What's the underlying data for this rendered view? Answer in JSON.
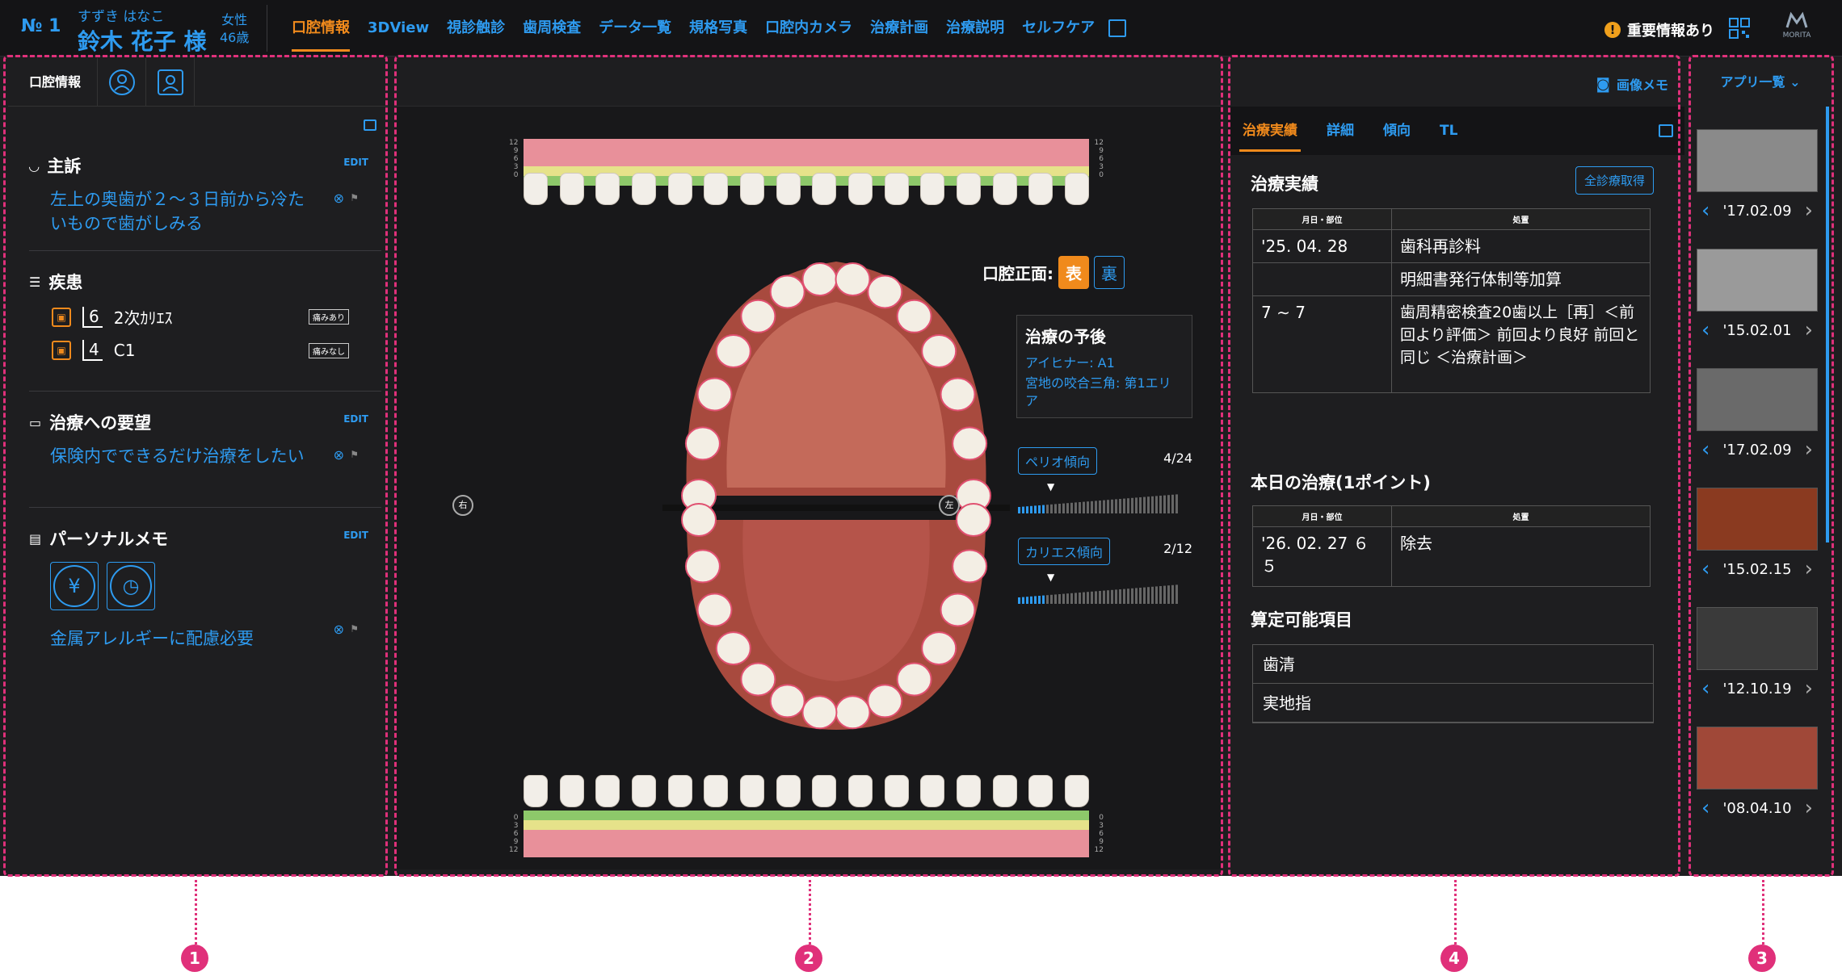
{
  "patient": {
    "number": "№ 1",
    "kana": "すずき はなこ",
    "name": "鈴木 花子 様",
    "sex": "女性",
    "age": "46歳"
  },
  "nav": {
    "tabs": [
      "口腔情報",
      "3DView",
      "視診触診",
      "歯周検査",
      "データ一覧",
      "規格写真",
      "口腔内カメラ",
      "治療計画",
      "治療説明",
      "セルフケア"
    ],
    "active_index": 0
  },
  "header": {
    "notice": "重要情報あり",
    "brand": "MORITA"
  },
  "left": {
    "title": "口腔情報",
    "complaint_title": "主訴",
    "complaint_text": "左上の奥歯が２～３日前から冷たいもので歯がしみる",
    "edit": "EDIT",
    "disease_title": "疾患",
    "diseases": [
      {
        "tooth": "6",
        "name": "2次ｶﾘｴｽ",
        "badge": "痛みあり"
      },
      {
        "tooth": "4",
        "name": "C1",
        "badge": "痛みなし"
      }
    ],
    "request_title": "治療への要望",
    "request_text": "保険内でできるだけ治療をしたい",
    "memo_title": "パーソナルメモ",
    "memo_text": "金属アレルギーに配慮必要",
    "memo_icons": [
      "yen-icon",
      "clock-icon"
    ]
  },
  "center": {
    "surface_label": "口腔正面:",
    "surface_front": "表",
    "surface_back": "裏",
    "prognosis_title": "治療の予後",
    "prognosis_line1": "アイヒナー: A1",
    "prognosis_line2": "宮地の咬合三角: 第1エリア",
    "perio_label": "ペリオ傾向",
    "perio_value": "4/24",
    "perio_fraction": 0.1667,
    "caries_label": "カリエス傾向",
    "caries_value": "2/12",
    "caries_fraction": 0.1667,
    "right_label": "右",
    "left_label": "左",
    "chart_ticks": [
      "12",
      "9",
      "6",
      "3",
      "0"
    ]
  },
  "right": {
    "photo_memo": "画像メモ",
    "tabs": [
      "治療実績",
      "詳細",
      "傾向",
      "TL"
    ],
    "active_tab": 0,
    "history_title": "治療実績",
    "fetch_button": "全診療取得",
    "col_date": "月日・部位",
    "col_action": "処置",
    "history_rows": [
      {
        "date": "'25. 04. 28",
        "action": "歯科再診料"
      },
      {
        "date": "",
        "action": "明細書発行体制等加算"
      },
      {
        "date": "7 ∼ 7",
        "action": "歯周精密検査20歯以上［再］＜前回より評価＞ 前回より良好 前回と同じ ＜治療計画＞"
      }
    ],
    "today_title": "本日の治療(1ポイント)",
    "today_rows": [
      {
        "date": "'26. 02. 27 ６５ ",
        "action": "除去"
      }
    ],
    "calc_title": "算定可能項目",
    "calc_items": [
      "歯清",
      "実地指"
    ]
  },
  "thumbs": {
    "menu": "アプリ一覧",
    "items": [
      {
        "date": "'17.02.09",
        "color": "#8a8a8a"
      },
      {
        "date": "'15.02.01",
        "color": "#9a9a9a"
      },
      {
        "date": "'17.02.09",
        "color": "#6a6a6a"
      },
      {
        "date": "'15.02.15",
        "color": "#8a3a20"
      },
      {
        "date": "'12.10.19",
        "color": "#3a3a3a"
      },
      {
        "date": "'08.04.10",
        "color": "#a04838"
      }
    ]
  },
  "markers": [
    "1",
    "2",
    "4",
    "3"
  ],
  "colors": {
    "accent": "#2e9bf0",
    "active": "#f08a1c",
    "frame": "#e0307a",
    "background": "#1e1e20"
  }
}
